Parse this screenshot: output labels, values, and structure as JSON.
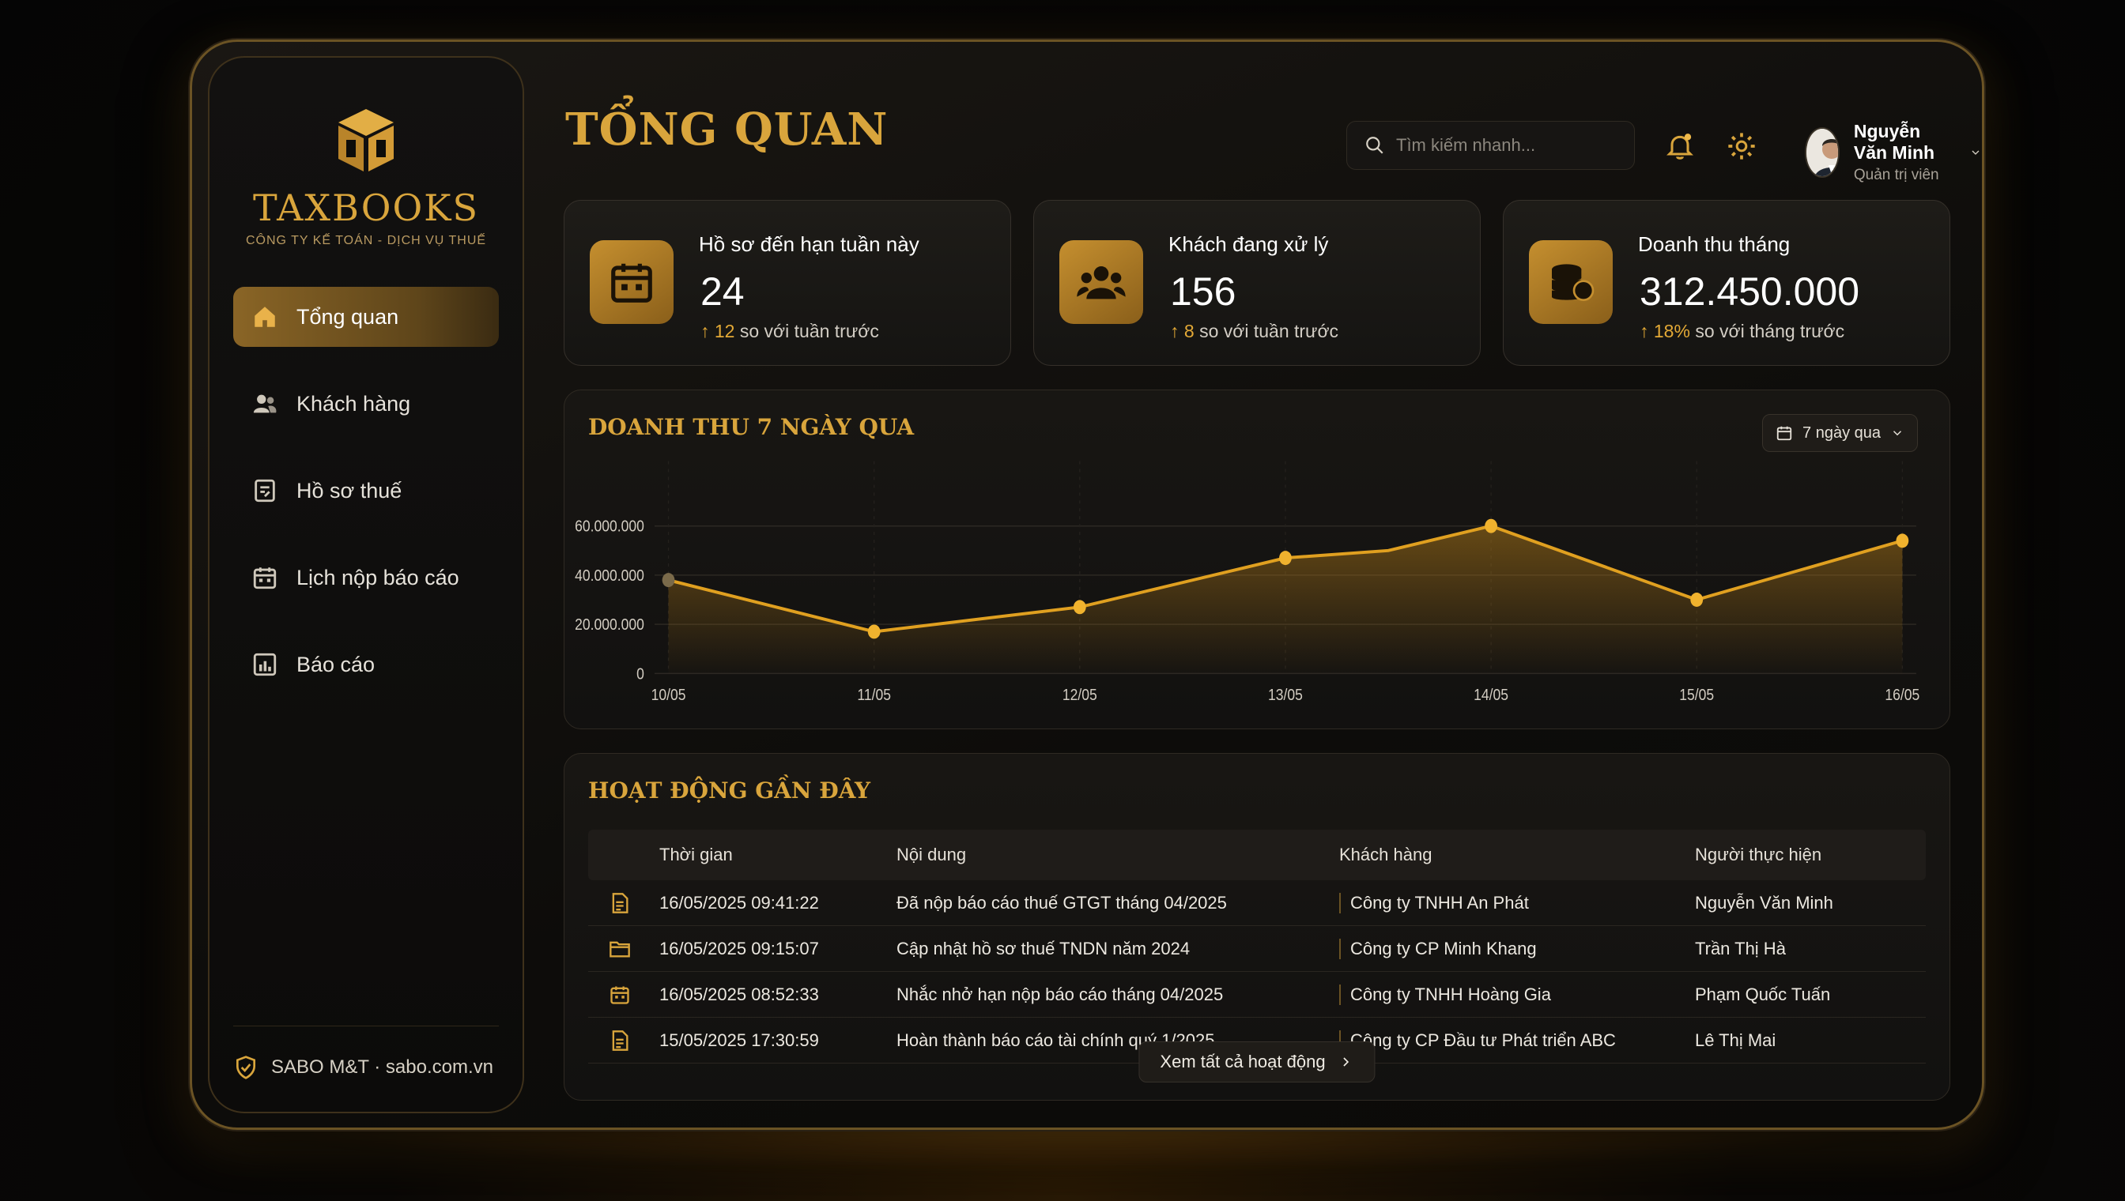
{
  "brand": {
    "name": "TAXBOOKS",
    "tagline": "CÔNG TY KẾ TOÁN - DỊCH VỤ THUẾ",
    "accent": "#d9a53c"
  },
  "sidebar": {
    "items": [
      {
        "label": "Tổng quan",
        "icon": "home-icon",
        "active": true
      },
      {
        "label": "Khách hàng",
        "icon": "users-icon",
        "active": false
      },
      {
        "label": "Hồ sơ thuế",
        "icon": "tax-file-icon",
        "active": false
      },
      {
        "label": "Lịch nộp báo cáo",
        "icon": "calendar-icon",
        "active": false
      },
      {
        "label": "Báo cáo",
        "icon": "report-chart-icon",
        "active": false
      }
    ],
    "footer": "SABO M&T · sabo.com.vn"
  },
  "header": {
    "title": "TỔNG QUAN",
    "search_placeholder": "Tìm kiếm nhanh...",
    "user": {
      "name": "Nguyễn Văn Minh",
      "role": "Quản trị viên"
    }
  },
  "cards": [
    {
      "label": "Hồ sơ đến hạn tuần này",
      "value": "24",
      "delta": "12",
      "delta_text": " so với tuần trước",
      "icon": "calendar-icon"
    },
    {
      "label": "Khách đang xử lý",
      "value": "156",
      "delta": "8",
      "delta_text": " so với tuần trước",
      "icon": "users-icon"
    },
    {
      "label": "Doanh thu tháng",
      "value": "312.450.000",
      "delta": "18%",
      "delta_text": " so với tháng trước",
      "icon": "coins-icon"
    }
  ],
  "chart_panel": {
    "title": "DOANH THU 7 NGÀY QUA",
    "range_label": "7 ngày qua"
  },
  "chart_data": {
    "type": "area",
    "title": "DOANH THU 7 NGÀY QUA",
    "x": [
      "10/05",
      "11/05",
      "12/05",
      "13/05",
      "14/05",
      "15/05",
      "16/05"
    ],
    "points_x": [
      0,
      1,
      2,
      3,
      3.5,
      4,
      5,
      6
    ],
    "series": [
      {
        "values": [
          38000000,
          17000000,
          27000000,
          47000000,
          50000000,
          60000000,
          30000000,
          54000000
        ],
        "color": "#e0a020"
      }
    ],
    "ylim": [
      0,
      80000000
    ],
    "y_ticks": [
      "0",
      "20.000.000",
      "40.000.000",
      "60.000.000",
      "80.000.000"
    ],
    "grid": true
  },
  "activity": {
    "title": "HOẠT ĐỘNG GẦN ĐÂY",
    "columns": [
      "Thời gian",
      "Nội dung",
      "Khách hàng",
      "Người thực hiện"
    ],
    "rows": [
      {
        "icon": "document-icon",
        "time": "16/05/2025 09:41:22",
        "content": "Đã nộp báo cáo thuế GTGT tháng 04/2025",
        "customer": "Công ty TNHH An Phát",
        "user": "Nguyễn Văn Minh"
      },
      {
        "icon": "folder-icon",
        "time": "16/05/2025 09:15:07",
        "content": "Cập nhật hồ sơ thuế TNDN năm 2024",
        "customer": "Công ty CP Minh Khang",
        "user": "Trần Thị Hà"
      },
      {
        "icon": "calendar-icon",
        "time": "16/05/2025 08:52:33",
        "content": "Nhắc nhở hạn nộp báo cáo tháng 04/2025",
        "customer": "Công ty TNHH Hoàng Gia",
        "user": "Phạm Quốc Tuấn"
      },
      {
        "icon": "document-icon",
        "time": "15/05/2025 17:30:59",
        "content": "Hoàn thành báo cáo tài chính quý 1/2025",
        "customer": "Công ty CP Đầu tư Phát triển ABC",
        "user": "Lê Thị Mai"
      }
    ],
    "see_all": "Xem tất cả hoạt động"
  }
}
